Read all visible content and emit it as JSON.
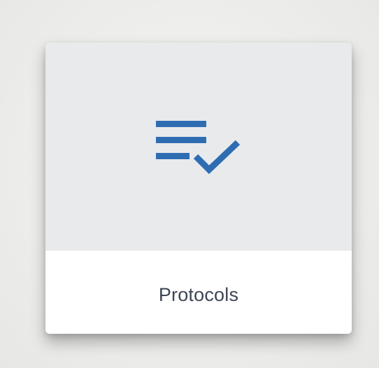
{
  "card": {
    "label": "Protocols",
    "icon": "playlist-check-icon"
  },
  "colors": {
    "icon_blue": "#2f6db3",
    "card_top_bg": "#e9eaec",
    "card_bottom_bg": "#ffffff",
    "label_text": "#3d4654"
  }
}
